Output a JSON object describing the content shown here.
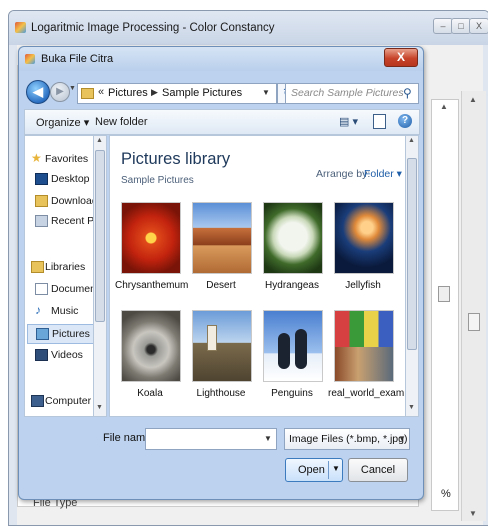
{
  "main_window": {
    "title": "Logaritmic Image Processing - Color Constancy",
    "controls": [
      "–",
      "□",
      "X"
    ],
    "percent_label": "%",
    "behind_label": "File Type"
  },
  "dialog": {
    "title": "Buka File Citra",
    "close_label": "X",
    "breadcrumb": [
      "Pictures",
      "Sample Pictures"
    ],
    "search_placeholder": "Search Sample Pictures",
    "toolbar": {
      "organize": "Organize ▾",
      "new_folder": "New folder"
    },
    "nav_sections": [
      {
        "label": "Favorites",
        "icon": "star-icon",
        "header": true
      },
      {
        "label": "Desktop",
        "icon": "desktop-icon"
      },
      {
        "label": "Downloads",
        "icon": "downloads-icon"
      },
      {
        "label": "Recent Plac",
        "icon": "recent-places-icon"
      },
      {
        "label": "Libraries",
        "icon": "libraries-icon",
        "header": true
      },
      {
        "label": "Documents",
        "icon": "documents-icon"
      },
      {
        "label": "Music",
        "icon": "music-icon"
      },
      {
        "label": "Pictures",
        "icon": "pictures-icon",
        "selected": true
      },
      {
        "label": "Videos",
        "icon": "videos-icon"
      },
      {
        "label": "Computer",
        "icon": "computer-icon",
        "header": true
      }
    ],
    "library": {
      "title": "Pictures library",
      "subtitle": "Sample Pictures",
      "arrange_by_label": "Arrange by:",
      "arrange_by_value": "Folder ▾",
      "items": [
        {
          "name": "Chrysanthemum"
        },
        {
          "name": "Desert"
        },
        {
          "name": "Hydrangeas"
        },
        {
          "name": "Jellyfish"
        },
        {
          "name": "Koala"
        },
        {
          "name": "Lighthouse"
        },
        {
          "name": "Penguins"
        },
        {
          "name": "real_world_exam"
        }
      ]
    },
    "file_name_label": "File name:",
    "file_name_value": "",
    "file_type_filter": "Image Files (*.bmp, *.jpg)",
    "open_label": "Open",
    "cancel_label": "Cancel"
  }
}
